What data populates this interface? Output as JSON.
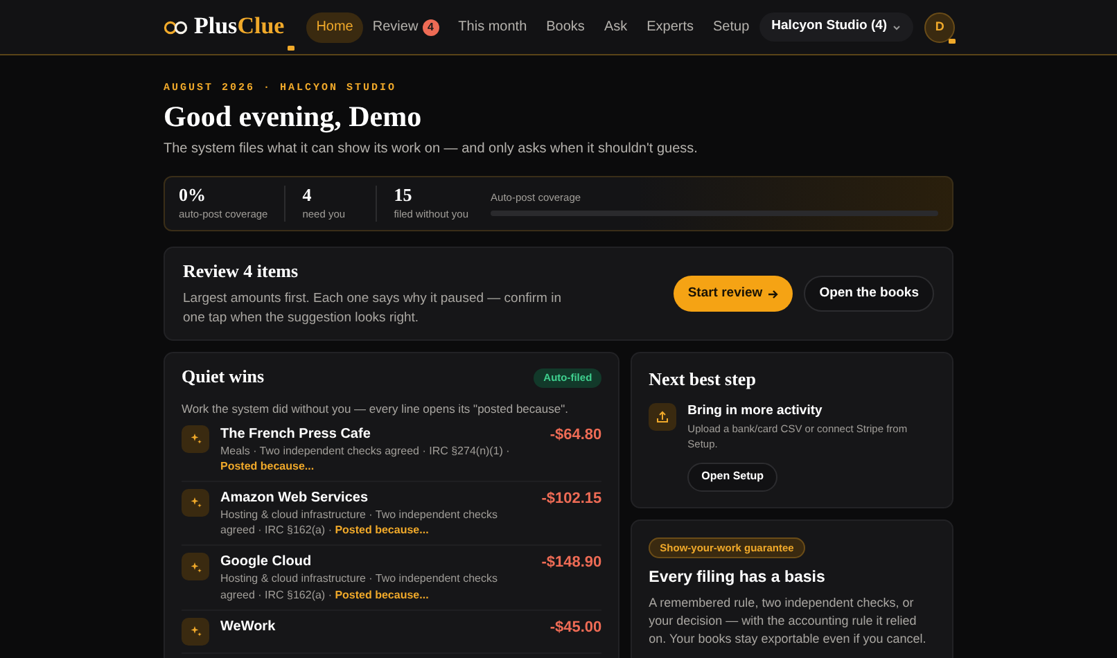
{
  "brand": {
    "name_part_1": "Plus",
    "name_part_2": "Clue"
  },
  "nav": [
    {
      "label": "Home",
      "selected": true
    },
    {
      "label": "Review",
      "selected": false,
      "badge": "4"
    },
    {
      "label": "This month",
      "selected": false
    },
    {
      "label": "Books",
      "selected": false
    },
    {
      "label": "Ask",
      "selected": false
    },
    {
      "label": "Experts",
      "selected": false
    },
    {
      "label": "Setup",
      "selected": false
    }
  ],
  "org_switcher": "Halcyon Studio (4)",
  "avatar": "D",
  "eyebrow": "AUGUST 2026 · HALCYON STUDIO",
  "greeting": "Good evening, Demo",
  "tagline": "The system files what it can show its work on — and only asks when it shouldn't guess.",
  "stats": [
    {
      "value": "0%",
      "label": "auto-post coverage"
    },
    {
      "value": "4",
      "label": "need you"
    },
    {
      "value": "15",
      "label": "filed without you"
    }
  ],
  "coverage": {
    "label": "Auto-post coverage",
    "level": 0
  },
  "review": {
    "title": "Review 4 items",
    "text": "Largest amounts first. Each one says why it paused — confirm in one tap when the suggestion looks right.",
    "primary": "Start review",
    "secondary": "Open the books"
  },
  "quiet_wins": {
    "title": "Quiet wins",
    "badge": "Auto-filed",
    "intro": "Work the system did without you — every line opens its \"posted because\".",
    "rows": [
      {
        "name": "The French Press Cafe",
        "meta": "Meals · Two independent checks agreed · IRC §274(n)(1) · ",
        "link": "Posted because...",
        "amount": "-$64.80"
      },
      {
        "name": "Amazon Web Services",
        "meta": "Hosting & cloud infrastructure · Two independent checks agreed · IRC §162(a) · ",
        "link": "Posted because...",
        "amount": "-$102.15"
      },
      {
        "name": "Google Cloud",
        "meta": "Hosting & cloud infrastructure · Two independent checks agreed · IRC §162(a) · ",
        "link": "Posted because...",
        "amount": "-$148.90"
      },
      {
        "name": "WeWork",
        "amount": "-$45.00"
      }
    ]
  },
  "next_step": {
    "title": "Next best step",
    "heading": "Bring in more activity",
    "text": "Upload a bank/card CSV or connect Stripe from Setup.",
    "button": "Open Setup"
  },
  "guarantee": {
    "badge": "Show-your-work guarantee",
    "title": "Every filing has a basis",
    "text": "A remembered rule, two independent checks, or your decision — with the accounting rule it relied on. Your books stay exportable even if you cancel."
  }
}
